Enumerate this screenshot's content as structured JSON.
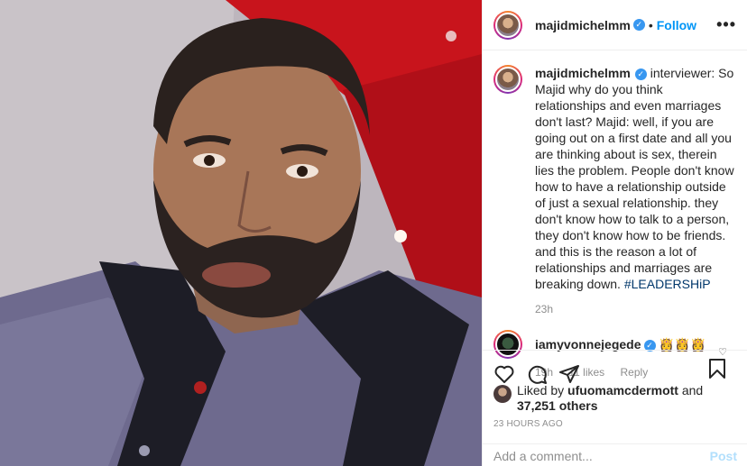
{
  "post": {
    "username": "majidmichelmm",
    "follow_label": "Follow",
    "dot": "•",
    "more_label": "•••"
  },
  "caption": {
    "username": "majidmichelmm",
    "text": " interviewer: So Majid why do you think relationships and even marriages don't last? Majid: well, if you are going out on a first date and all you are thinking about is sex, therein lies the problem. People don't know how to have a relationship outside of just a sexual relationship. they don't know how to talk to a person, they don't know how to be friends. and this is the reason a lot of relationships and marriages are breaking down. ",
    "hashtag": "#LEADERSHiP",
    "time": "23h"
  },
  "comment": {
    "username": "iamyvonnejegede",
    "text": " 👸👸👸",
    "time": "19h",
    "likes": "11 likes",
    "reply": "Reply"
  },
  "likes": {
    "prefix": "Liked by ",
    "user": "ufuomamcdermott",
    "and": " and",
    "others": "37,251 others"
  },
  "timestamp": "23 HOURS AGO",
  "add_comment": {
    "placeholder": "Add a comment...",
    "post_label": "Post"
  },
  "colors": {
    "accent": "#0095f6",
    "verified": "#3897f0",
    "muted": "#8e8e8e",
    "wall_red": "#c8141c"
  },
  "icons": {
    "like": "heart-icon",
    "comment": "comment-icon",
    "share": "share-icon",
    "save": "bookmark-icon"
  }
}
